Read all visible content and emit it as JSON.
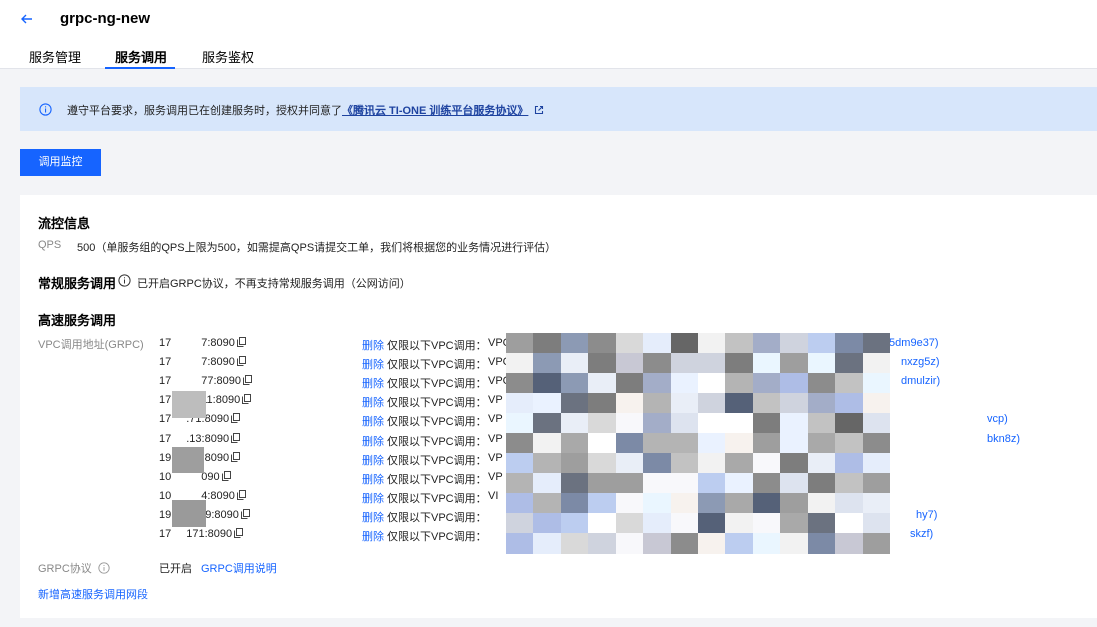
{
  "header": {
    "title": "grpc-ng-new",
    "tabs": [
      {
        "label": "服务管理"
      },
      {
        "label": "服务调用"
      },
      {
        "label": "服务鉴权"
      }
    ]
  },
  "notice": {
    "text": "遵守平台要求，服务调用已在创建服务时，授权并同意了",
    "link": "《腾讯云 TI-ONE 训练平台服务协议》"
  },
  "monitor_button": "调用监控",
  "flow": {
    "heading": "流控信息",
    "qps_label": "QPS",
    "qps_value": "500（单服务组的QPS上限为500，如需提高QPS请提交工单，我们将根据您的业务情况进行评估）"
  },
  "regular": {
    "heading": "常规服务调用",
    "note": "已开启GRPC协议，不再支持常规服务调用（公网访问）"
  },
  "highspeed": {
    "heading": "高速服务调用",
    "vpc_label": "VPC调用地址(GRPC)",
    "delete_label": "删除",
    "only_label": "仅限以下VPC调用：",
    "rows": [
      {
        "ip_start": "17",
        "ip_end": "7:8090",
        "vpc": "VPC",
        "vpc_tail": "f5dm9e37)"
      },
      {
        "ip_start": "17",
        "ip_end": "7:8090",
        "vpc": "VPC",
        "vpc_tail": "nxzg5z)"
      },
      {
        "ip_start": "17",
        "ip_end": "77:8090",
        "vpc": "VPC",
        "vpc_tail": "dmulzir)"
      },
      {
        "ip_start": "17",
        "ip_end": "11:8090",
        "vpc": "VP",
        "vpc_tail": ""
      },
      {
        "ip_start": "17",
        "ip_end": ".71:8090",
        "vpc": "VP",
        "vpc_tail": "vcp)"
      },
      {
        "ip_start": "17",
        "ip_end": ".13:8090",
        "vpc": "VP",
        "vpc_tail": "bkn8z)"
      },
      {
        "ip_start": "19",
        "ip_end": ".17:8090",
        "vpc": "VP",
        "vpc_tail": ""
      },
      {
        "ip_start": "10",
        "ip_end": "090",
        "vpc": "VP",
        "vpc_tail": ""
      },
      {
        "ip_start": "10",
        "ip_end": "4:8090",
        "vpc": "VI",
        "vpc_tail": ""
      },
      {
        "ip_start": "19",
        "ip_end": ").129:8090",
        "vpc": "",
        "vpc_tail": "hy7)"
      },
      {
        "ip_start": "17",
        "ip_end": "171:8090",
        "vpc": "",
        "vpc_tail": "skzf)"
      }
    ],
    "grpc_label": "GRPC协议",
    "grpc_status": "已开启",
    "grpc_doc_link": "GRPC调用说明",
    "add_link": "新增高速服务调用网段"
  },
  "colors": {
    "accent": "#1664ff",
    "notice_bg": "#d7e6fb",
    "page_bg": "#f3f4f7"
  },
  "icons": [
    "back-arrow-icon",
    "info-icon",
    "external-link-icon",
    "copy-icon"
  ]
}
